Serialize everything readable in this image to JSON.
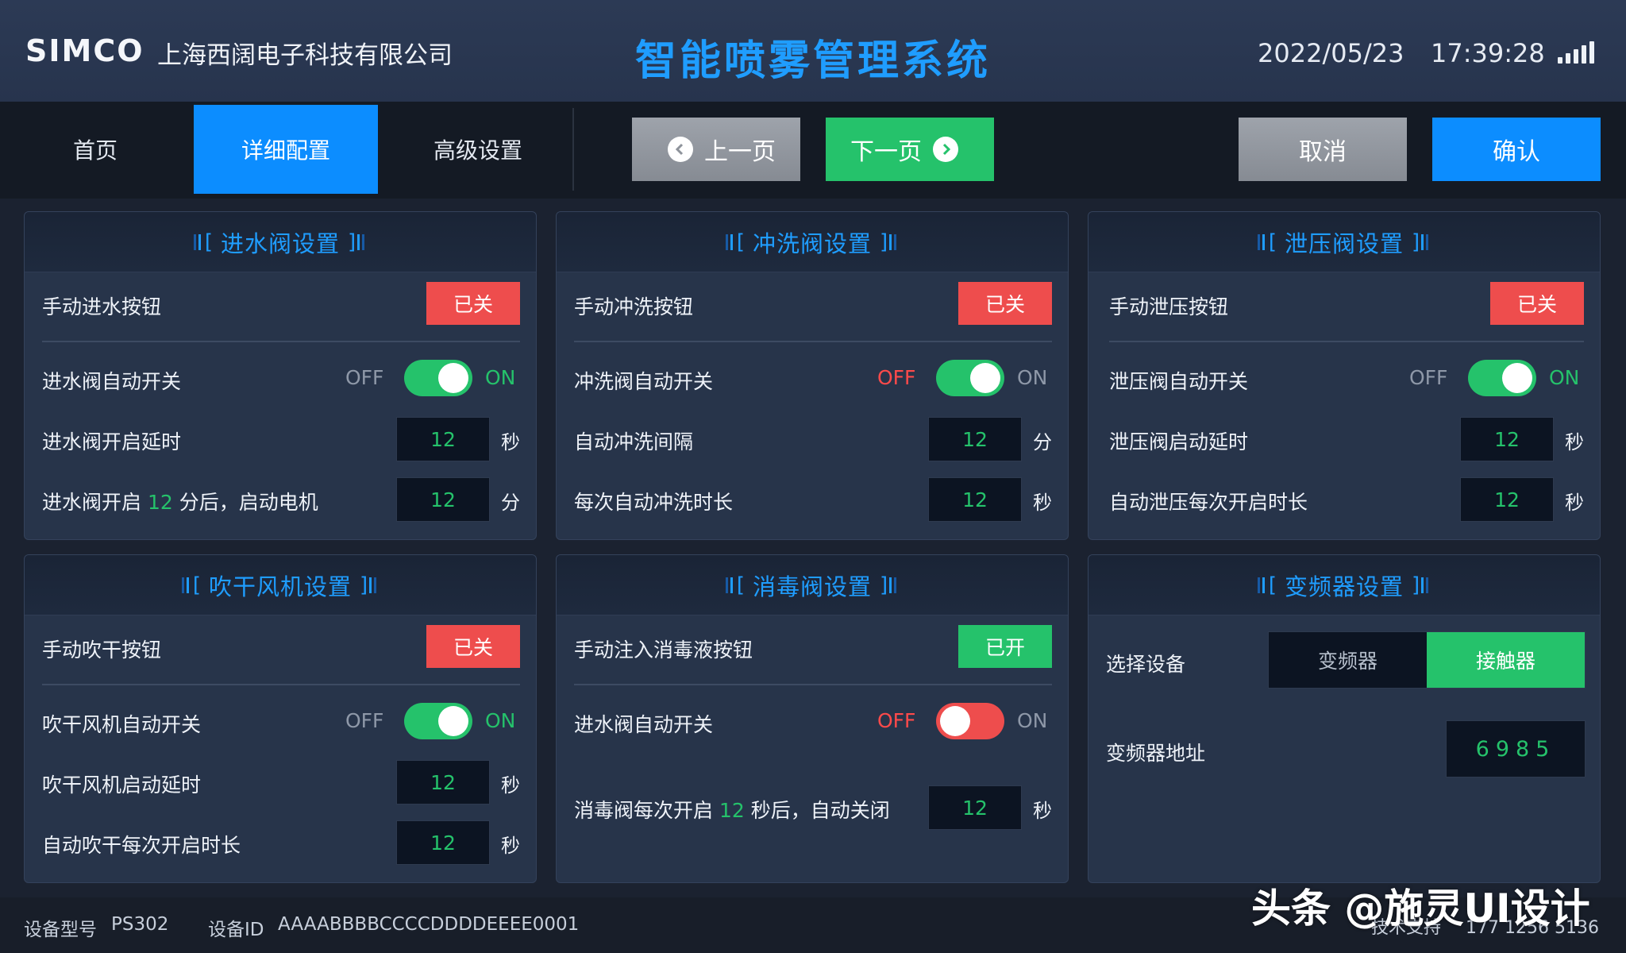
{
  "header": {
    "logo": "SIMCO",
    "company": "上海西阔电子科技有限公司",
    "title": "智能喷雾管理系统",
    "date": "2022/05/23",
    "time": "17:39:28"
  },
  "nav": {
    "tabs": [
      {
        "label": "首页",
        "active": false
      },
      {
        "label": "详细配置",
        "active": true
      },
      {
        "label": "高级设置",
        "active": false
      }
    ],
    "prev_label": "上一页",
    "next_label": "下一页",
    "cancel_label": "取消",
    "confirm_label": "确认"
  },
  "panels": {
    "inlet": {
      "title": "进水阀设置",
      "manual_label": "手动进水按钮",
      "manual_state": "已关",
      "auto_label": "进水阀自动开关",
      "auto_on": true,
      "delay_label": "进水阀开启延时",
      "delay_value": "12",
      "delay_unit": "秒",
      "motor_prefix": "进水阀开启",
      "motor_minutes": "12",
      "motor_suffix": "分后，启动电机",
      "motor_value": "12",
      "motor_unit": "分"
    },
    "flush": {
      "title": "冲洗阀设置",
      "manual_label": "手动冲洗按钮",
      "manual_state": "已关",
      "auto_label": "冲洗阀自动开关",
      "auto_on": true,
      "interval_label": "自动冲洗间隔",
      "interval_value": "12",
      "interval_unit": "分",
      "duration_label": "每次自动冲洗时长",
      "duration_value": "12",
      "duration_unit": "秒"
    },
    "relief": {
      "title": "泄压阀设置",
      "manual_label": "手动泄压按钮",
      "manual_state": "已关",
      "auto_label": "泄压阀自动开关",
      "auto_on": true,
      "delay_label": "泄压阀启动延时",
      "delay_value": "12",
      "delay_unit": "秒",
      "duration_label": "自动泄压每次开启时长",
      "duration_value": "12",
      "duration_unit": "秒"
    },
    "dryer": {
      "title": "吹干风机设置",
      "manual_label": "手动吹干按钮",
      "manual_state": "已关",
      "auto_label": "吹干风机自动开关",
      "auto_on": true,
      "delay_label": "吹干风机启动延时",
      "delay_value": "12",
      "delay_unit": "秒",
      "duration_label": "自动吹干每次开启时长",
      "duration_value": "12",
      "duration_unit": "秒"
    },
    "disinfect": {
      "title": "消毒阀设置",
      "manual_label": "手动注入消毒液按钮",
      "manual_state": "已开",
      "auto_label": "进水阀自动开关",
      "auto_on": false,
      "close_prefix": "消毒阀每次开启",
      "close_seconds": "12",
      "close_suffix": "秒后，自动关闭",
      "close_value": "12",
      "close_unit": "秒"
    },
    "inverter": {
      "title": "变频器设置",
      "device_label": "选择设备",
      "options": [
        "变频器",
        "接触器"
      ],
      "selected_option": "接触器",
      "address_label": "变频器地址",
      "address_value": "6985"
    }
  },
  "switch_text": {
    "off": "OFF",
    "on": "ON"
  },
  "footer": {
    "model_label": "设备型号",
    "model_value": "PS302",
    "id_label": "设备ID",
    "id_value": "AAAABBBBCCCCDDDDEEEE0001",
    "support_label": "技术支持",
    "support_phone": "177 1256 5136",
    "watermark": "头条 @施灵UI设计"
  },
  "colors": {
    "accent_blue": "#0c8dff",
    "title_blue": "#1f9dff",
    "on_green": "#25c26b",
    "off_red": "#ee4d4d"
  }
}
